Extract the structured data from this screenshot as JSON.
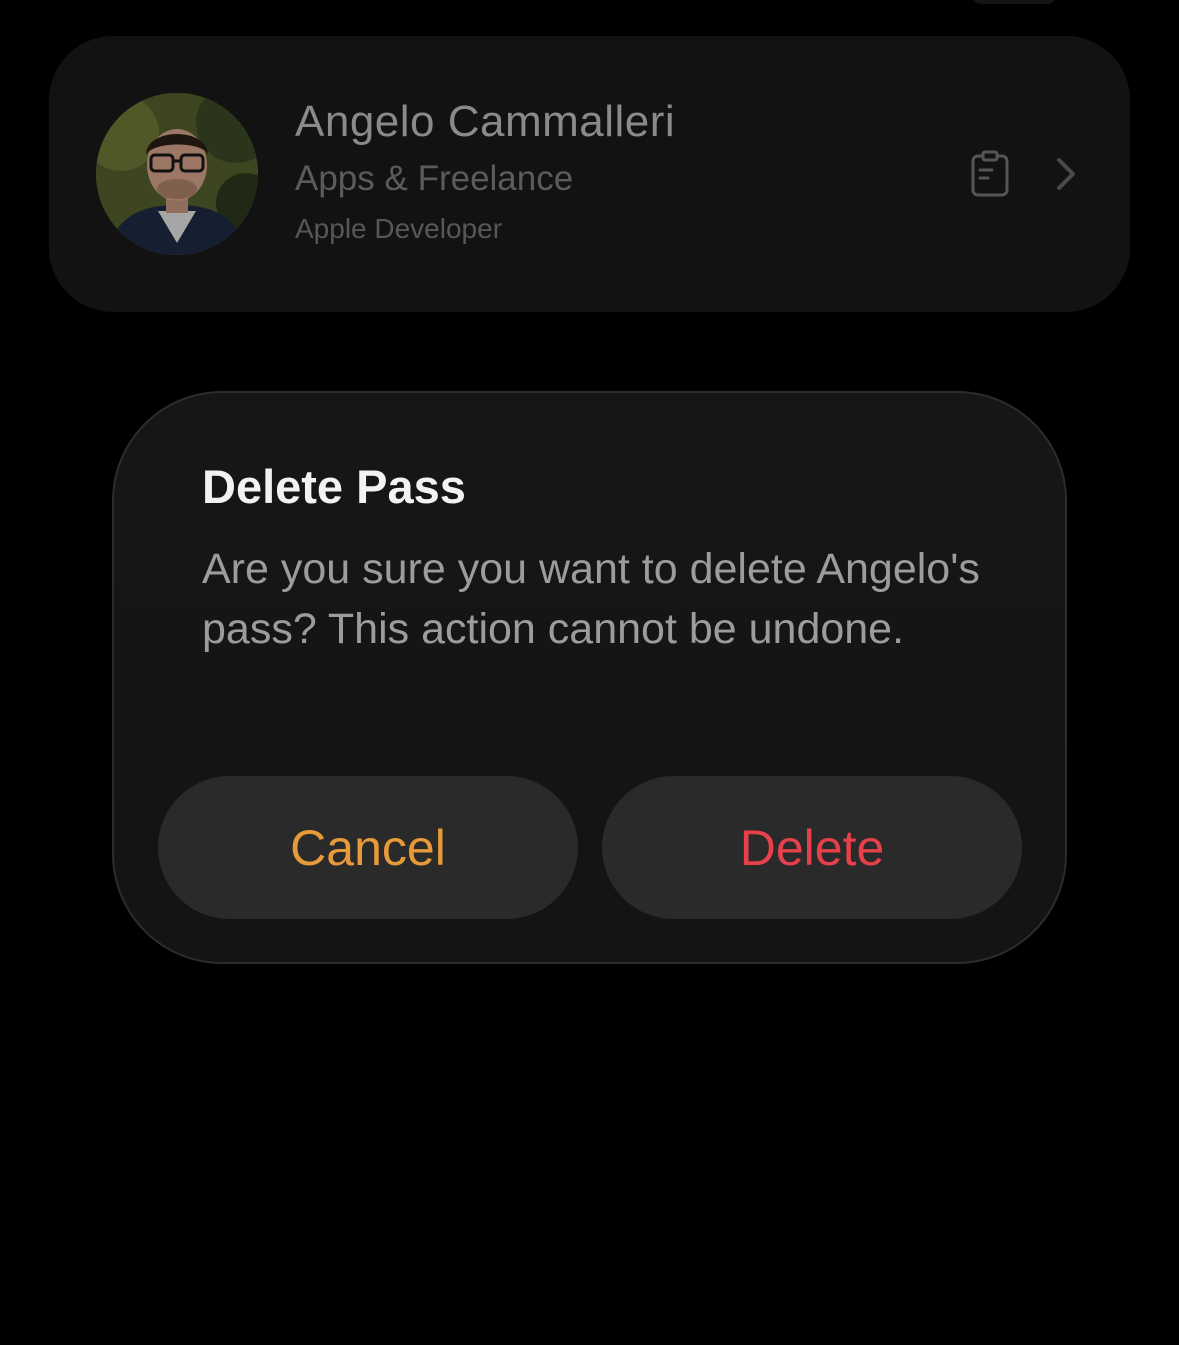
{
  "pass_card": {
    "name": "Angelo Cammalleri",
    "subtitle": "Apps & Freelance",
    "caption": "Apple Developer",
    "avatar_icon": "person-photo",
    "action_icon": "notes-icon",
    "disclosure_icon": "chevron-right-icon"
  },
  "dialog": {
    "title": "Delete Pass",
    "message": "Are you sure you want to delete Angelo's pass? This action cannot be undone.",
    "cancel_label": "Cancel",
    "delete_label": "Delete"
  },
  "colors": {
    "background": "#000000",
    "card": "#121212",
    "dialog": "#161616",
    "button": "#2a2a2a",
    "cancel": "#e69a3a",
    "destructive": "#e8404a"
  }
}
